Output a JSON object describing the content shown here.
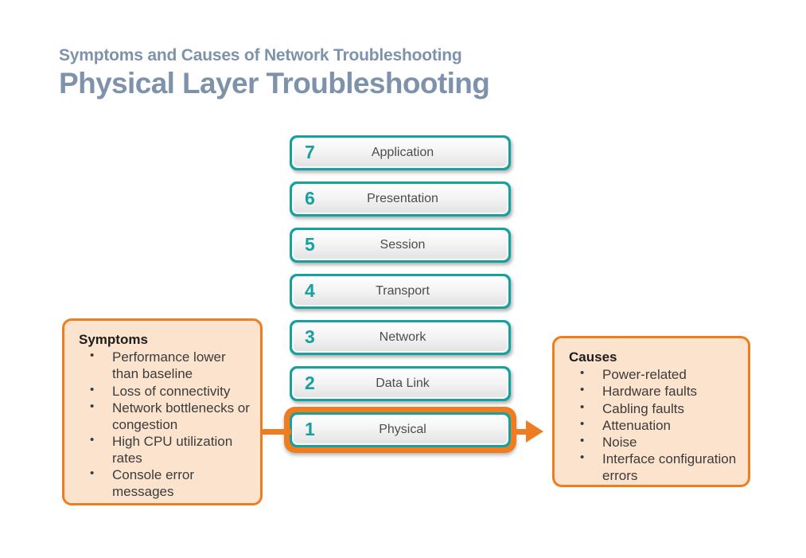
{
  "header": {
    "subtitle": "Symptoms and Causes of Network Troubleshooting",
    "title": "Physical Layer Troubleshooting",
    "title_color": "#7e93ab"
  },
  "colors": {
    "teal": "#16a0a0",
    "orange": "#ee7c20",
    "peach_fill": "#fce3cd",
    "background": "#ffffff"
  },
  "osi_stack": {
    "layers": [
      {
        "number": "7",
        "name": "Application",
        "highlighted": false
      },
      {
        "number": "6",
        "name": "Presentation",
        "highlighted": false
      },
      {
        "number": "5",
        "name": "Session",
        "highlighted": false
      },
      {
        "number": "4",
        "name": "Transport",
        "highlighted": false
      },
      {
        "number": "3",
        "name": "Network",
        "highlighted": false
      },
      {
        "number": "2",
        "name": "Data Link",
        "highlighted": false
      },
      {
        "number": "1",
        "name": "Physical",
        "highlighted": true
      }
    ]
  },
  "symptoms": {
    "title": "Symptoms",
    "items": [
      "Performance lower than baseline",
      "Loss of connectivity",
      "Network bottlenecks or congestion",
      "High CPU utilization rates",
      "Console error messages"
    ]
  },
  "causes": {
    "title": "Causes",
    "items": [
      "Power-related",
      "Hardware faults",
      "Cabling faults",
      "Attenuation",
      "Noise",
      "Interface configuration errors"
    ]
  }
}
